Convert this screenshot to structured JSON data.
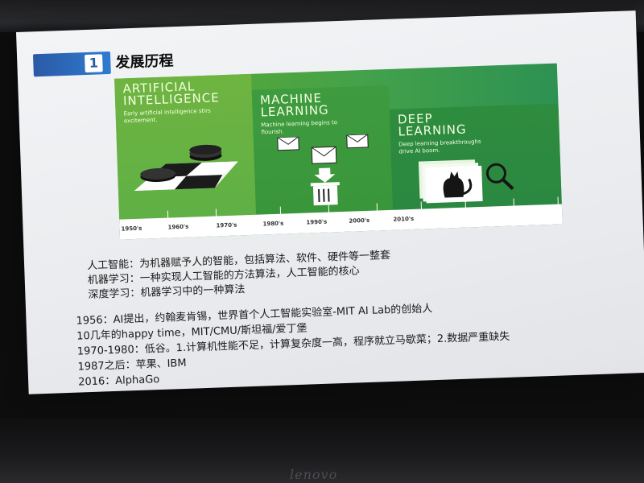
{
  "slide": {
    "section_number": "1",
    "title": "发展历程"
  },
  "timeline": {
    "panels": [
      {
        "title_line1": "ARTIFICIAL",
        "title_line2": "INTELLIGENCE",
        "subtitle": "Early artificial intelligence stirs excitement."
      },
      {
        "title_line1": "MACHINE",
        "title_line2": "LEARNING",
        "subtitle": "Machine learning begins to flourish."
      },
      {
        "title_line1": "DEEP",
        "title_line2": "LEARNING",
        "subtitle": "Deep learning breakthroughs drive AI boom."
      }
    ],
    "decades": [
      "1950's",
      "1960's",
      "1970's",
      "1980's",
      "1990's",
      "2000's",
      "2010's"
    ]
  },
  "definitions": [
    "人工智能：为机器赋予人的智能，包括算法、软件、硬件等一整套",
    "机器学习：一种实现人工智能的方法算法，人工智能的核心",
    "深度学习：机器学习中的一种算法"
  ],
  "history": [
    "1956：AI提出，约翰麦肯锡，世界首个人工智能实验室-MIT  AI Lab的创始人",
    "10几年的happy time，MIT/CMU/斯坦福/爱丁堡",
    "1970-1980：低谷。1.计算机性能不足，计算复杂度一高，程序就立马歇菜；2.数据严重缺失",
    "1987之后：苹果、IBM",
    "2016：AlphaGo"
  ],
  "monitor": {
    "brand": "lenovo"
  }
}
